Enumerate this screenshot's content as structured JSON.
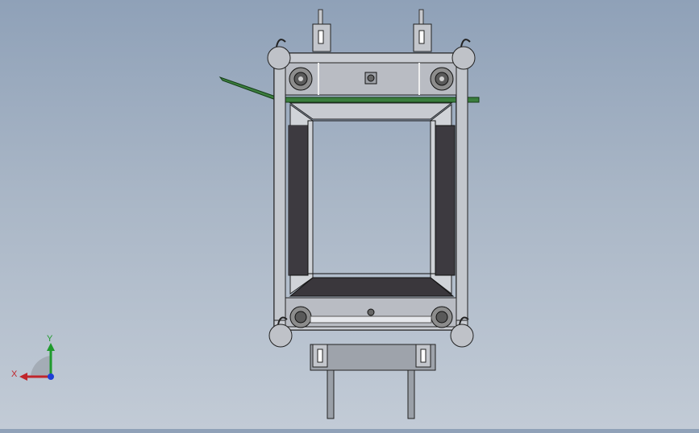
{
  "window": {
    "title": ""
  },
  "viewport": {
    "background_top": "#8fa1b8",
    "background_bottom": "#c2cbd6",
    "model": {
      "frame_color": "#b9bec7",
      "frame_edge": "#2a2a2a",
      "panel_dark": "#3d3a40",
      "guide_color": "#2f6e34",
      "roller_color": "#6a6a6a"
    }
  },
  "triad": {
    "x_label": "X",
    "y_label": "Y",
    "x_color": "#c0252b",
    "y_color": "#1f9a2d",
    "z_color": "#1e3fd6"
  }
}
